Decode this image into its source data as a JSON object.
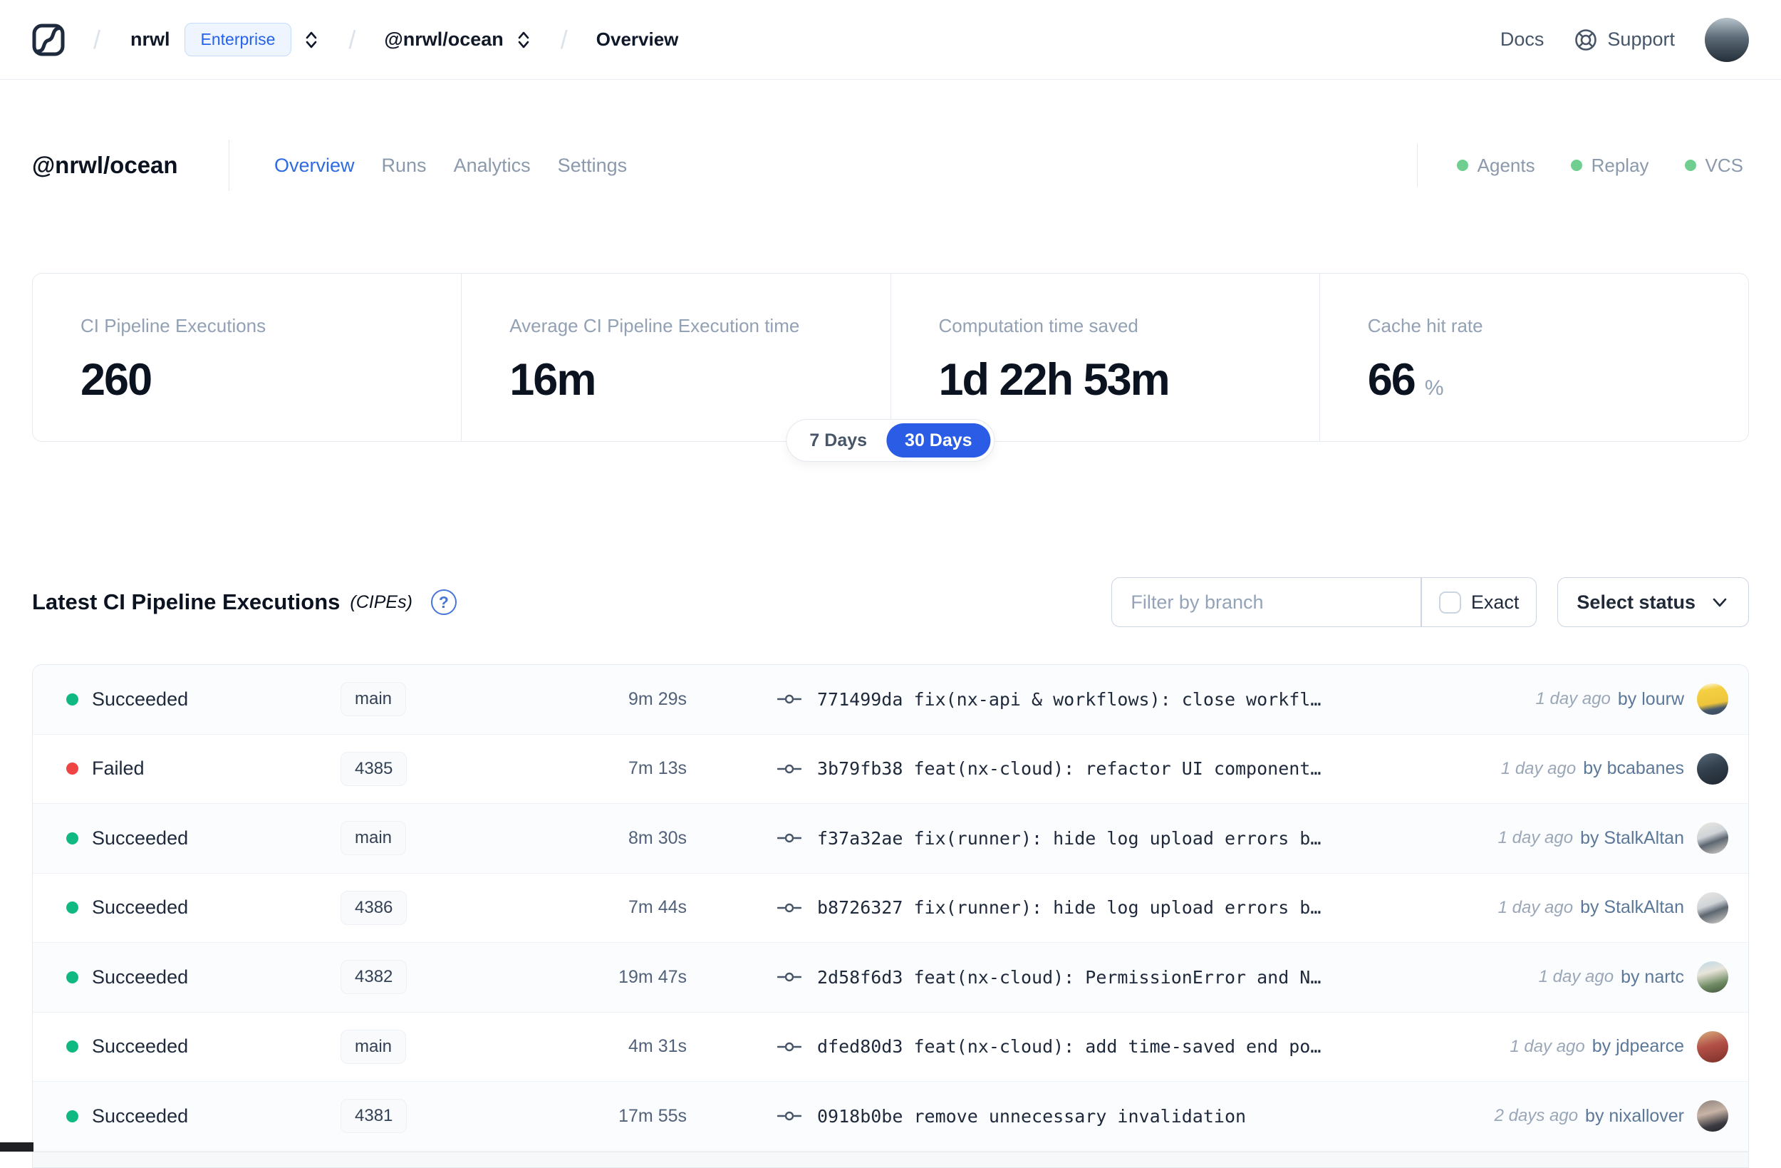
{
  "colors": {
    "accent_blue": "#2563eb",
    "toggle_selected_blue": "#2b5ce5",
    "tab_active_blue": "#2f6be0",
    "success_green": "#10b981",
    "failed_red": "#ef4444",
    "service_dot_green": "#6fcf8f"
  },
  "header": {
    "breadcrumb": {
      "separator": "/",
      "org": "nrwl",
      "plan_badge": "Enterprise",
      "workspace": "@nrwl/ocean",
      "page": "Overview"
    },
    "nav": {
      "docs": "Docs",
      "support": "Support"
    }
  },
  "workspace": {
    "title": "@nrwl/ocean",
    "tabs": [
      {
        "label": "Overview",
        "active": true
      },
      {
        "label": "Runs",
        "active": false
      },
      {
        "label": "Analytics",
        "active": false
      },
      {
        "label": "Settings",
        "active": false
      }
    ],
    "services": [
      {
        "label": "Agents",
        "dot_color": "#6fcf8f"
      },
      {
        "label": "Replay",
        "dot_color": "#6fcf8f"
      },
      {
        "label": "VCS",
        "dot_color": "#6fcf8f"
      }
    ]
  },
  "stats": {
    "cards": [
      {
        "label": "CI Pipeline Executions",
        "value": "260",
        "suffix": ""
      },
      {
        "label": "Average CI Pipeline Execution time",
        "value": "16m",
        "suffix": ""
      },
      {
        "label": "Computation time saved",
        "value": "1d 22h 53m",
        "suffix": ""
      },
      {
        "label": "Cache hit rate",
        "value": "66",
        "suffix": "%"
      }
    ]
  },
  "range_toggle": {
    "options": [
      "7 Days",
      "30 Days"
    ],
    "selected": "30 Days"
  },
  "cipe_section": {
    "title": "Latest CI Pipeline Executions",
    "subtitle": "(CIPEs)",
    "help_glyph": "?",
    "filter_placeholder": "Filter by branch",
    "exact_label": "Exact",
    "status_dropdown_label": "Select status"
  },
  "table": {
    "rows": [
      {
        "status": "Succeeded",
        "status_color": "#10b981",
        "branch": "main",
        "duration": "9m 29s",
        "commit": "771499da fix(nx-api & workflows): close workfl…",
        "age": "1 day ago",
        "author": "by lourw",
        "avatar_gradient": "linear-gradient(170deg,#ffffff 0%,#f5d043 22%,#eec53a 62%,#46586c 78%,#38465a 100%)"
      },
      {
        "status": "Failed",
        "status_color": "#ef4444",
        "branch": "4385",
        "duration": "7m 13s",
        "commit": "3b79fb38 feat(nx-cloud): refactor UI component…",
        "age": "1 day ago",
        "author": "by bcabanes",
        "avatar_gradient": "linear-gradient(160deg,#5a6a7a 0%,#33404d 45%,#1e2630 100%)"
      },
      {
        "status": "Succeeded",
        "status_color": "#10b981",
        "branch": "main",
        "duration": "8m 30s",
        "commit": "f37a32ae fix(runner): hide log upload errors b…",
        "age": "1 day ago",
        "author": "by StalkAltan",
        "avatar_gradient": "linear-gradient(160deg,#ece8e1 0%,#cfd4d8 40%,#5d6670 60%,#dad7cf 100%)"
      },
      {
        "status": "Succeeded",
        "status_color": "#10b981",
        "branch": "4386",
        "duration": "7m 44s",
        "commit": "b8726327 fix(runner): hide log upload errors b…",
        "age": "1 day ago",
        "author": "by StalkAltan",
        "avatar_gradient": "linear-gradient(160deg,#ece8e1 0%,#cfd4d8 40%,#5d6670 60%,#dad7cf 100%)"
      },
      {
        "status": "Succeeded",
        "status_color": "#10b981",
        "branch": "4382",
        "duration": "19m 47s",
        "commit": "2d58f6d3 feat(nx-cloud): PermissionError and N…",
        "age": "1 day ago",
        "author": "by nartc",
        "avatar_gradient": "linear-gradient(165deg,#bcd9e8 0%,#e8e4da 35%,#6e8a62 70%,#41563d 100%)"
      },
      {
        "status": "Succeeded",
        "status_color": "#10b981",
        "branch": "main",
        "duration": "4m 31s",
        "commit": "dfed80d3 feat(nx-cloud): add time-saved end po…",
        "age": "1 day ago",
        "author": "by jdpearce",
        "avatar_gradient": "linear-gradient(165deg,#d8b07e 0%,#b35148 45%,#7c2f28 100%)"
      },
      {
        "status": "Succeeded",
        "status_color": "#10b981",
        "branch": "4381",
        "duration": "17m 55s",
        "commit": "0918b0be remove unnecessary invalidation",
        "age": "2 days ago",
        "author": "by nixallover",
        "avatar_gradient": "linear-gradient(165deg,#8a817c 0%,#c9b4a6 40%,#3a3a40 75%,#232329 100%)"
      }
    ]
  }
}
